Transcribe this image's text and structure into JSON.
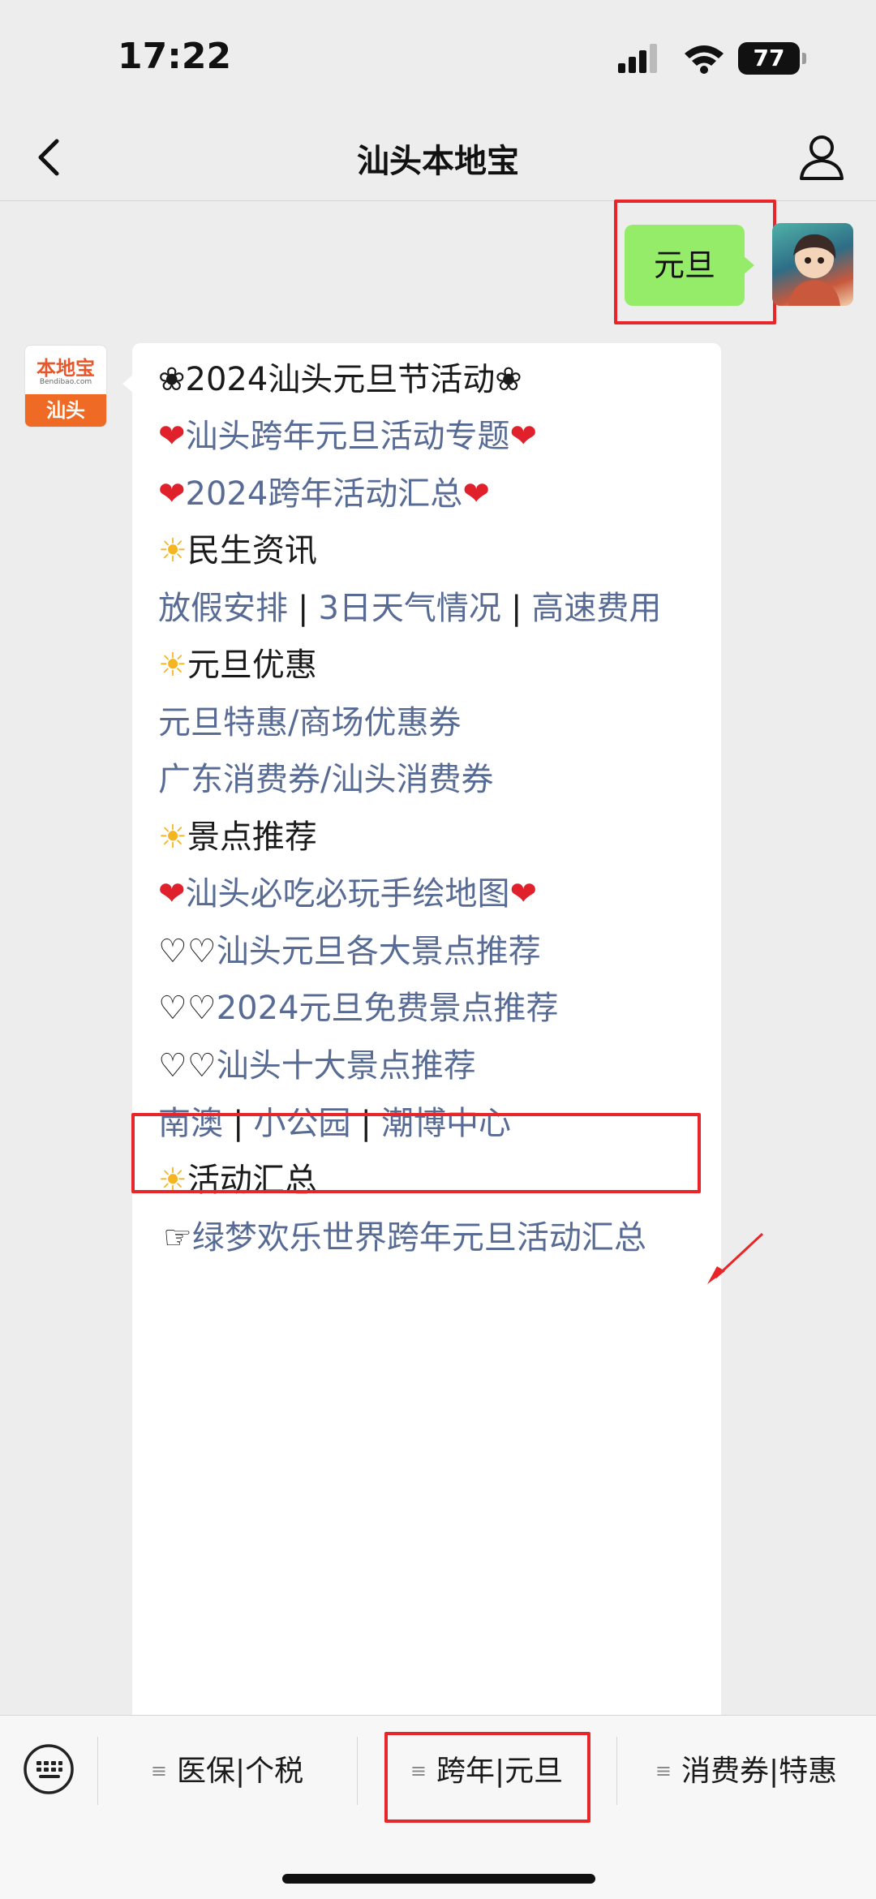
{
  "status_bar": {
    "time": "17:22",
    "battery": "77"
  },
  "nav": {
    "title": "汕头本地宝",
    "back_icon": "chevron-left-icon",
    "profile_icon": "person-icon"
  },
  "user_message": {
    "text": "元旦"
  },
  "bot_avatar": {
    "logo_text": "本地宝",
    "logo_domain": "Bendibao.com",
    "city": "汕头"
  },
  "bot_message": {
    "title": "❀2024汕头元旦节活动❀",
    "special_link": "汕头跨年元旦活动专题",
    "summary_link": "2024跨年活动汇总",
    "sections": {
      "livelihood": {
        "heading": "民生资讯",
        "links": [
          "放假安排",
          "3日天气情况",
          "高速费用"
        ]
      },
      "deals": {
        "heading": "元旦优惠",
        "line1": [
          "元旦特惠",
          "商场优惠券"
        ],
        "line2": [
          "广东消费券",
          "汕头消费券"
        ]
      },
      "attractions": {
        "heading": "景点推荐",
        "map_link": "汕头必吃必玩手绘地图",
        "items": [
          "汕头元旦各大景点推荐",
          "2024元旦免费景点推荐",
          "汕头十大景点推荐"
        ],
        "places": [
          "南澳",
          "小公园",
          "潮博中心"
        ]
      },
      "events": {
        "heading": "活动汇总",
        "link": "绿梦欢乐世界跨年元旦活动汇总"
      }
    }
  },
  "menu_bar": {
    "items": [
      "医保|个税",
      "跨年|元旦",
      "消费券|特惠"
    ]
  },
  "colors": {
    "bubble_user": "#95ec69",
    "link": "#576b95",
    "highlight": "#e8262a",
    "background": "#ededed"
  }
}
